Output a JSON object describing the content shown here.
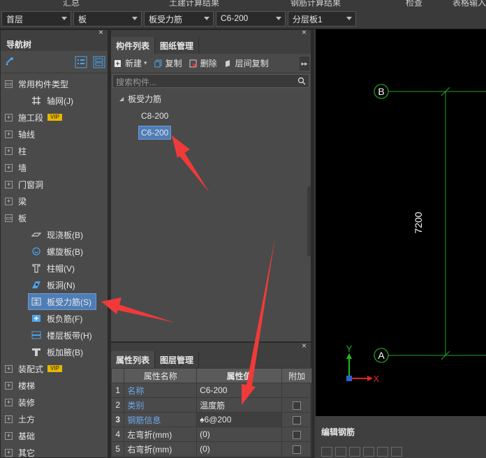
{
  "top_menu": [
    "汇总",
    "土建计算结果",
    "钢筋计算结果",
    "检查",
    "表格输入"
  ],
  "toolbar": {
    "floor": "首层",
    "category": "板",
    "type": "板受力筋",
    "spec": "C6-200",
    "layer": "分层板1"
  },
  "nav": {
    "title": "导航树",
    "items": [
      {
        "label": "常用构件类型",
        "expanded": true
      },
      {
        "label": "轴网(J)",
        "child": true
      },
      {
        "label": "施工段",
        "vip": "VIP"
      },
      {
        "label": "轴线"
      },
      {
        "label": "柱"
      },
      {
        "label": "墙"
      },
      {
        "label": "门窗洞"
      },
      {
        "label": "梁"
      },
      {
        "label": "板",
        "expanded": true
      },
      {
        "label": "现浇板(B)",
        "child": true
      },
      {
        "label": "螺旋板(B)",
        "child": true
      },
      {
        "label": "柱帽(V)",
        "child": true
      },
      {
        "label": "板洞(N)",
        "child": true
      },
      {
        "label": "板受力筋(S)",
        "child": true,
        "selected": true
      },
      {
        "label": "板负筋(F)",
        "child": true
      },
      {
        "label": "楼层板带(H)",
        "child": true
      },
      {
        "label": "板加腋(B)",
        "child": true
      },
      {
        "label": "装配式",
        "vip": "VIP"
      },
      {
        "label": "楼梯"
      },
      {
        "label": "装修"
      },
      {
        "label": "土方"
      },
      {
        "label": "基础"
      },
      {
        "label": "其它"
      }
    ]
  },
  "components": {
    "tabs": [
      "构件列表",
      "图纸管理"
    ],
    "toolbar": {
      "new": "新建",
      "copy": "复制",
      "delete": "删除",
      "floor_copy": "层间复制"
    },
    "search_placeholder": "搜索构件...",
    "group": "板受力筋",
    "items": [
      "C8-200",
      "C6-200"
    ]
  },
  "properties": {
    "tabs": [
      "属性列表",
      "图层管理"
    ],
    "headers": [
      "属性名称",
      "属性值",
      "附加"
    ],
    "rows": [
      {
        "n": "1",
        "name": "名称",
        "value": "C6-200",
        "highlight": true
      },
      {
        "n": "2",
        "name": "类别",
        "value": "温度筋",
        "highlight": true
      },
      {
        "n": "3",
        "name": "钢筋信息",
        "value": "♠6@200",
        "highlight": true
      },
      {
        "n": "4",
        "name": "左弯折(mm)",
        "value": "(0)",
        "highlight": false
      },
      {
        "n": "5",
        "name": "右弯折(mm)",
        "value": "(0)",
        "highlight": false
      }
    ]
  },
  "drawing": {
    "axis_top": "B",
    "axis_bottom": "A",
    "dimension": "7200",
    "y_axis": "Y",
    "x_axis": "X"
  },
  "rebar_edit": {
    "title": "编辑钢筋"
  },
  "colors": {
    "accent": "#4f7db5",
    "grid_green": "#1fa31f",
    "arrow_red": "#f03a3a"
  }
}
